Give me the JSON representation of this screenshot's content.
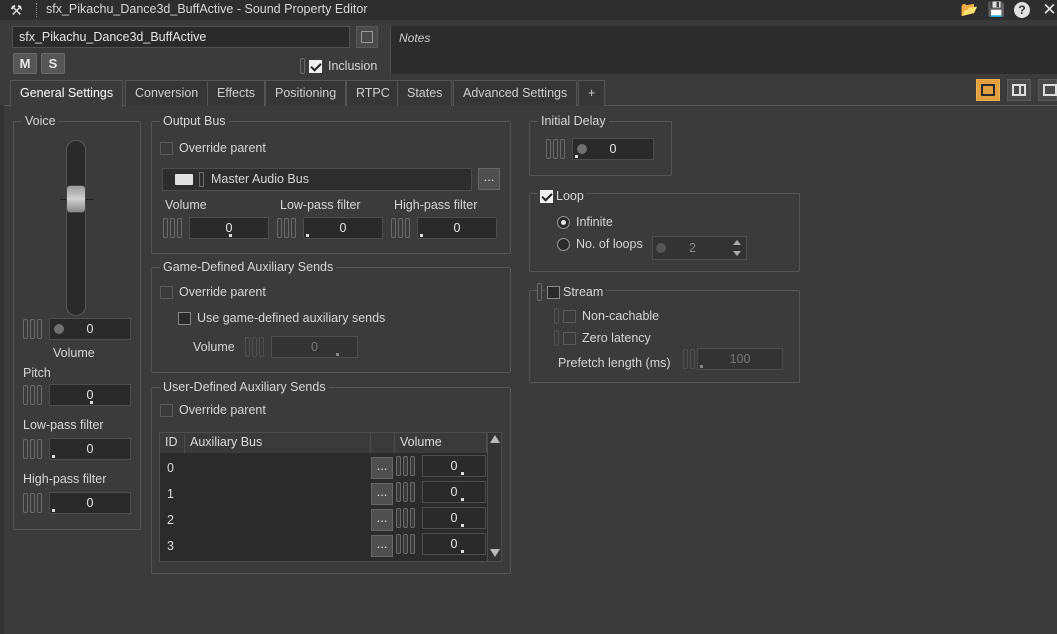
{
  "window": {
    "title": "sfx_Pikachu_Dance3d_BuffActive - Sound Property Editor"
  },
  "header": {
    "object_name": "sfx_Pikachu_Dance3d_BuffActive",
    "mute_label": "M",
    "solo_label": "S",
    "inclusion_label": "Inclusion",
    "inclusion_checked": true,
    "notes_label": "Notes"
  },
  "tabs": [
    {
      "label": "General Settings",
      "active": true
    },
    {
      "label": "Conversion"
    },
    {
      "label": "Effects"
    },
    {
      "label": "Positioning"
    },
    {
      "label": "RTPC"
    },
    {
      "label": "States"
    },
    {
      "label": "Advanced Settings"
    },
    {
      "label": "+"
    }
  ],
  "voice": {
    "title": "Voice",
    "volume_value": "0",
    "volume_label": "Volume",
    "pitch_label": "Pitch",
    "pitch_value": "0",
    "lowpass_label": "Low-pass filter",
    "lowpass_value": "0",
    "highpass_label": "High-pass filter",
    "highpass_value": "0"
  },
  "output_bus": {
    "title": "Output Bus",
    "override_label": "Override parent",
    "bus_name": "Master Audio Bus",
    "browse_label": "...",
    "volume_label": "Volume",
    "volume_value": "0",
    "lowpass_label": "Low-pass filter",
    "lowpass_value": "0",
    "highpass_label": "High-pass filter",
    "highpass_value": "0"
  },
  "game_aux": {
    "title": "Game-Defined Auxiliary Sends",
    "override_label": "Override parent",
    "use_label": "Use game-defined auxiliary sends",
    "volume_label": "Volume",
    "volume_value": "0"
  },
  "user_aux": {
    "title": "User-Defined Auxiliary Sends",
    "override_label": "Override parent",
    "col_id": "ID",
    "col_bus": "Auxiliary Bus",
    "col_volume": "Volume",
    "rows": [
      {
        "id": "0",
        "volume": "0"
      },
      {
        "id": "1",
        "volume": "0"
      },
      {
        "id": "2",
        "volume": "0"
      },
      {
        "id": "3",
        "volume": "0"
      }
    ],
    "browse_label": "..."
  },
  "initial_delay": {
    "title": "Initial Delay",
    "value": "0"
  },
  "loop": {
    "label": "Loop",
    "checked": true,
    "infinite_label": "Infinite",
    "count_label": "No. of loops",
    "count_value": "2"
  },
  "stream": {
    "label": "Stream",
    "checked": false,
    "noncachable_label": "Non-cachable",
    "zero_latency_label": "Zero latency",
    "prefetch_label": "Prefetch length (ms)",
    "prefetch_value": "100"
  },
  "colors": {
    "background": "#3b3b3b",
    "accent": "#e0a040"
  }
}
